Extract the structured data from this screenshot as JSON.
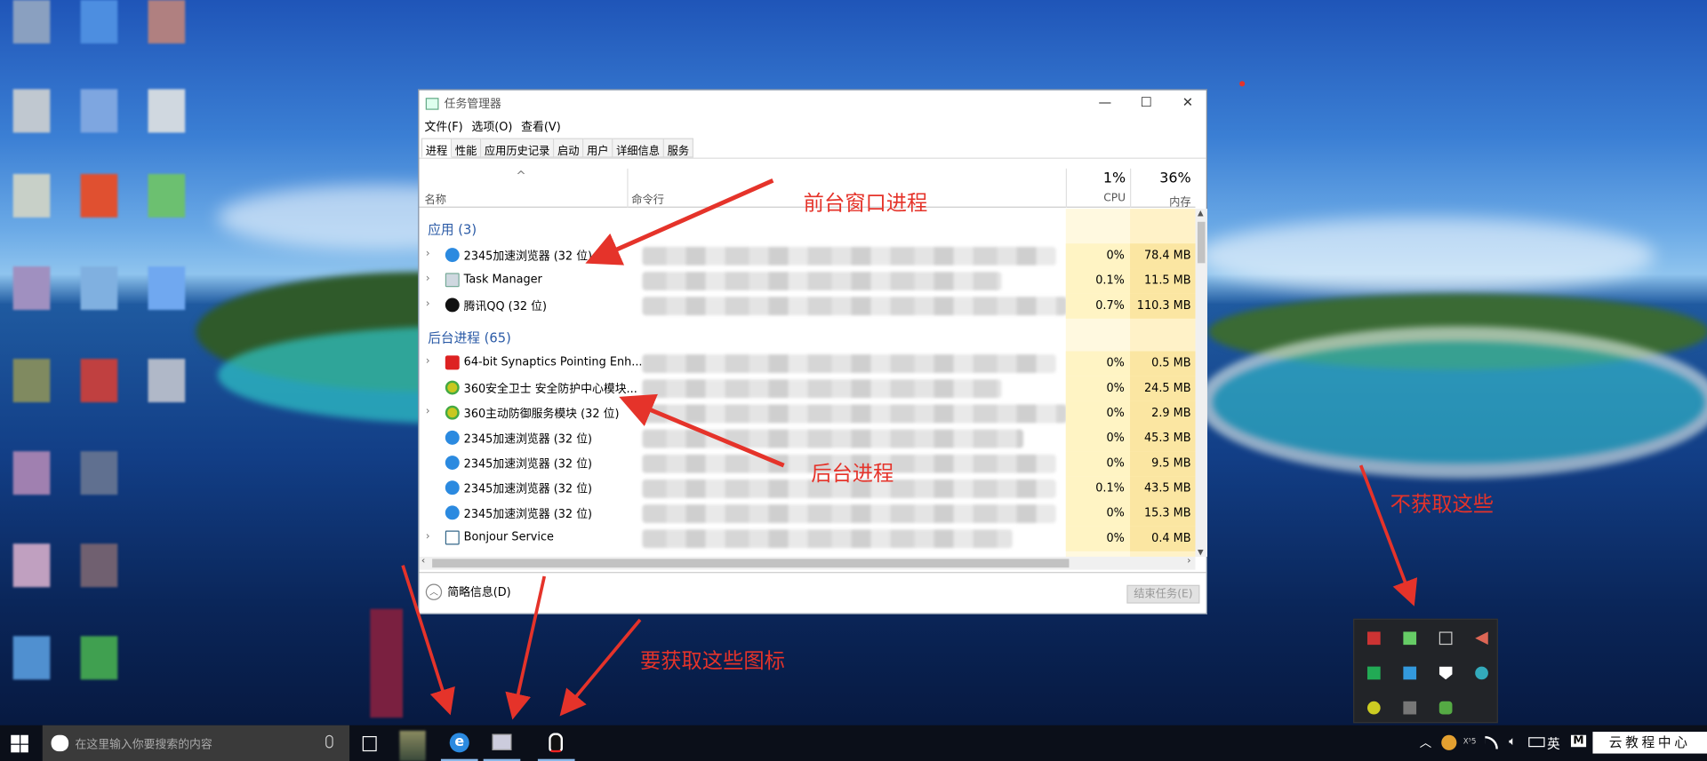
{
  "window": {
    "title": "任务管理器",
    "minimize": "—",
    "maximize": "☐",
    "close": "✕",
    "menu": [
      "文件(F)",
      "选项(O)",
      "查看(V)"
    ],
    "tabs": [
      "进程",
      "性能",
      "应用历史记录",
      "启动",
      "用户",
      "详细信息",
      "服务"
    ],
    "header": {
      "sort_arrow": "^",
      "name": "名称",
      "cmd": "命令行",
      "cpu_pct": "1%",
      "cpu": "CPU",
      "mem_pct": "36%",
      "mem": "内存"
    },
    "groups": {
      "apps": "应用 (3)",
      "background": "后台进程 (65)"
    },
    "apps": [
      {
        "name": "2345加速浏览器 (32 位)",
        "cpu": "0%",
        "mem": "78.4 MB",
        "icon": "ie-icon",
        "expand": true
      },
      {
        "name": "Task Manager",
        "cpu": "0.1%",
        "mem": "11.5 MB",
        "icon": "taskmgr-icon",
        "expand": true
      },
      {
        "name": "腾讯QQ (32 位)",
        "cpu": "0.7%",
        "mem": "110.3 MB",
        "icon": "qq-icon",
        "expand": true
      }
    ],
    "background": [
      {
        "name": "64-bit Synaptics Pointing Enh...",
        "cpu": "0%",
        "mem": "0.5 MB",
        "icon": "synaptics-icon",
        "expand": true
      },
      {
        "name": "360安全卫士 安全防护中心模块...",
        "cpu": "0%",
        "mem": "24.5 MB",
        "icon": "360-icon",
        "expand": false
      },
      {
        "name": "360主动防御服务模块 (32 位)",
        "cpu": "0%",
        "mem": "2.9 MB",
        "icon": "360-icon",
        "expand": true
      },
      {
        "name": "2345加速浏览器 (32 位)",
        "cpu": "0%",
        "mem": "45.3 MB",
        "icon": "ie-icon",
        "expand": false
      },
      {
        "name": "2345加速浏览器 (32 位)",
        "cpu": "0%",
        "mem": "9.5 MB",
        "icon": "ie-icon",
        "expand": false
      },
      {
        "name": "2345加速浏览器 (32 位)",
        "cpu": "0.1%",
        "mem": "43.5 MB",
        "icon": "ie-icon",
        "expand": false
      },
      {
        "name": "2345加速浏览器 (32 位)",
        "cpu": "0%",
        "mem": "15.3 MB",
        "icon": "ie-icon",
        "expand": false
      },
      {
        "name": "Bonjour Service",
        "cpu": "0%",
        "mem": "0.4 MB",
        "icon": "service-icon",
        "expand": true
      }
    ],
    "footer": {
      "fewer_details": "简略信息(D)",
      "end_task": "结束任务(E)"
    }
  },
  "annotations": {
    "foreground": "前台窗口进程",
    "background": "后台进程",
    "exclude": "不获取这些",
    "include": "要获取这些图标"
  },
  "taskbar": {
    "search_placeholder": "在这里输入你要搜索的内容",
    "tray": {
      "ime": "英",
      "m": "M",
      "x5": "X⁵5",
      "watermark": "云教程中心"
    }
  },
  "colors": {
    "accent": "#2a5aa6",
    "annotation": "#e5332a",
    "cpu_bg": "#fff4c4",
    "mem_bg": "#fbe6a2"
  }
}
